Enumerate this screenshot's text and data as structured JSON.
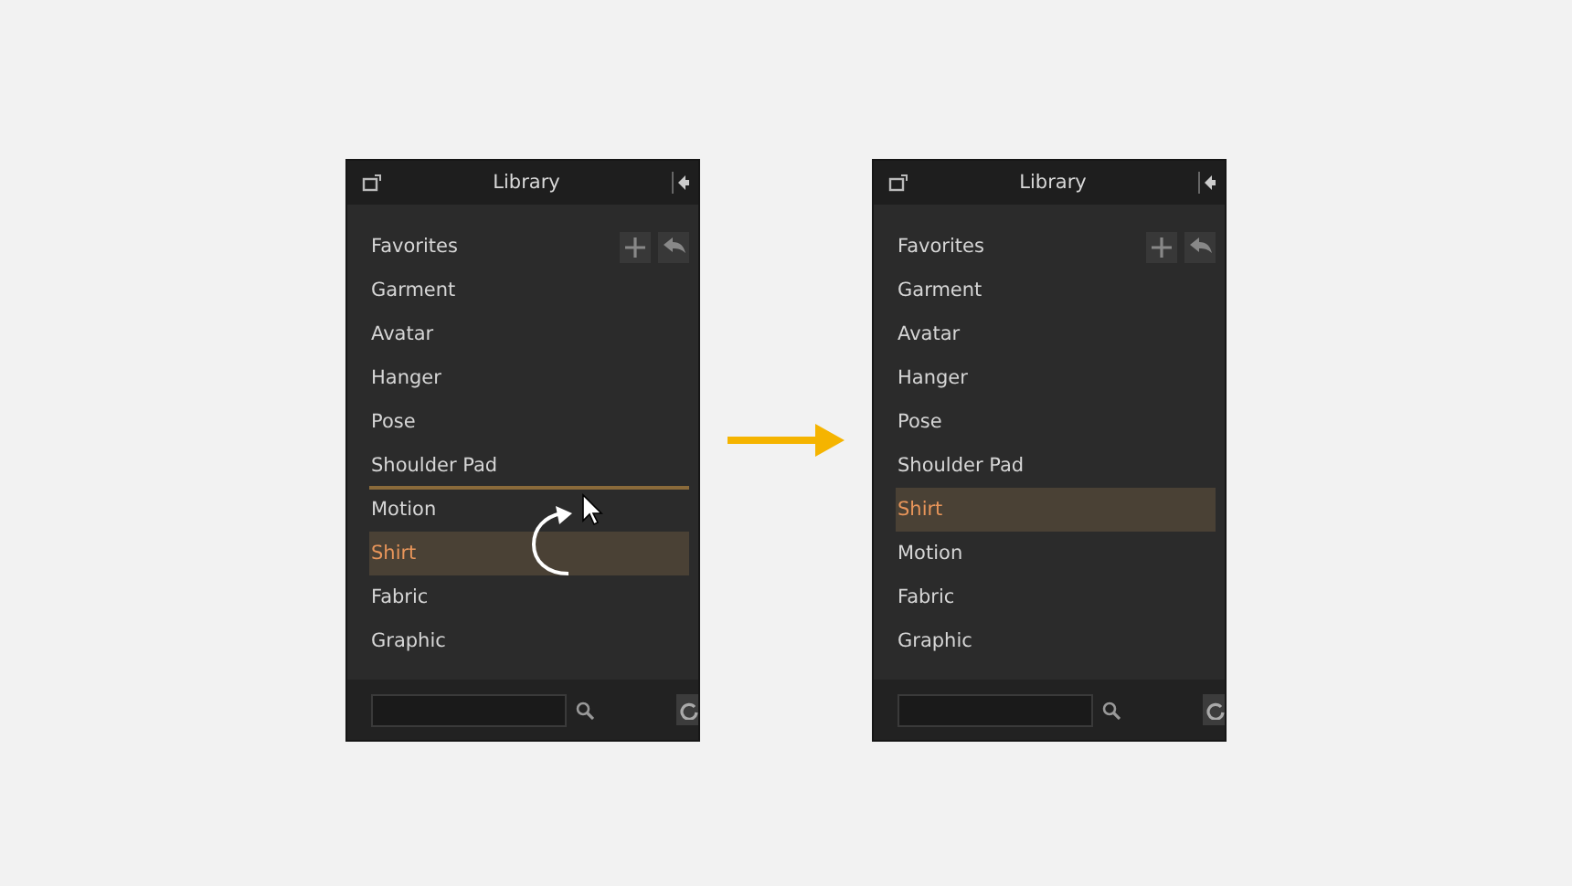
{
  "panels": [
    {
      "title": "Library",
      "drag_hint": true,
      "items": [
        {
          "label": "Favorites",
          "selected": false,
          "drop_below": false
        },
        {
          "label": "Garment",
          "selected": false,
          "drop_below": false
        },
        {
          "label": "Avatar",
          "selected": false,
          "drop_below": false
        },
        {
          "label": "Hanger",
          "selected": false,
          "drop_below": false
        },
        {
          "label": "Pose",
          "selected": false,
          "drop_below": false
        },
        {
          "label": "Shoulder Pad",
          "selected": false,
          "drop_below": true
        },
        {
          "label": "Motion",
          "selected": false,
          "drop_below": false
        },
        {
          "label": "Shirt",
          "selected": true,
          "drop_below": false
        },
        {
          "label": "Fabric",
          "selected": false,
          "drop_below": false
        },
        {
          "label": "Graphic",
          "selected": false,
          "drop_below": false
        }
      ]
    },
    {
      "title": "Library",
      "drag_hint": false,
      "items": [
        {
          "label": "Favorites",
          "selected": false,
          "drop_below": false
        },
        {
          "label": "Garment",
          "selected": false,
          "drop_below": false
        },
        {
          "label": "Avatar",
          "selected": false,
          "drop_below": false
        },
        {
          "label": "Hanger",
          "selected": false,
          "drop_below": false
        },
        {
          "label": "Pose",
          "selected": false,
          "drop_below": false
        },
        {
          "label": "Shoulder Pad",
          "selected": false,
          "drop_below": false
        },
        {
          "label": "Shirt",
          "selected": true,
          "drop_below": false
        },
        {
          "label": "Motion",
          "selected": false,
          "drop_below": false
        },
        {
          "label": "Fabric",
          "selected": false,
          "drop_below": false
        },
        {
          "label": "Graphic",
          "selected": false,
          "drop_below": false
        }
      ]
    }
  ]
}
